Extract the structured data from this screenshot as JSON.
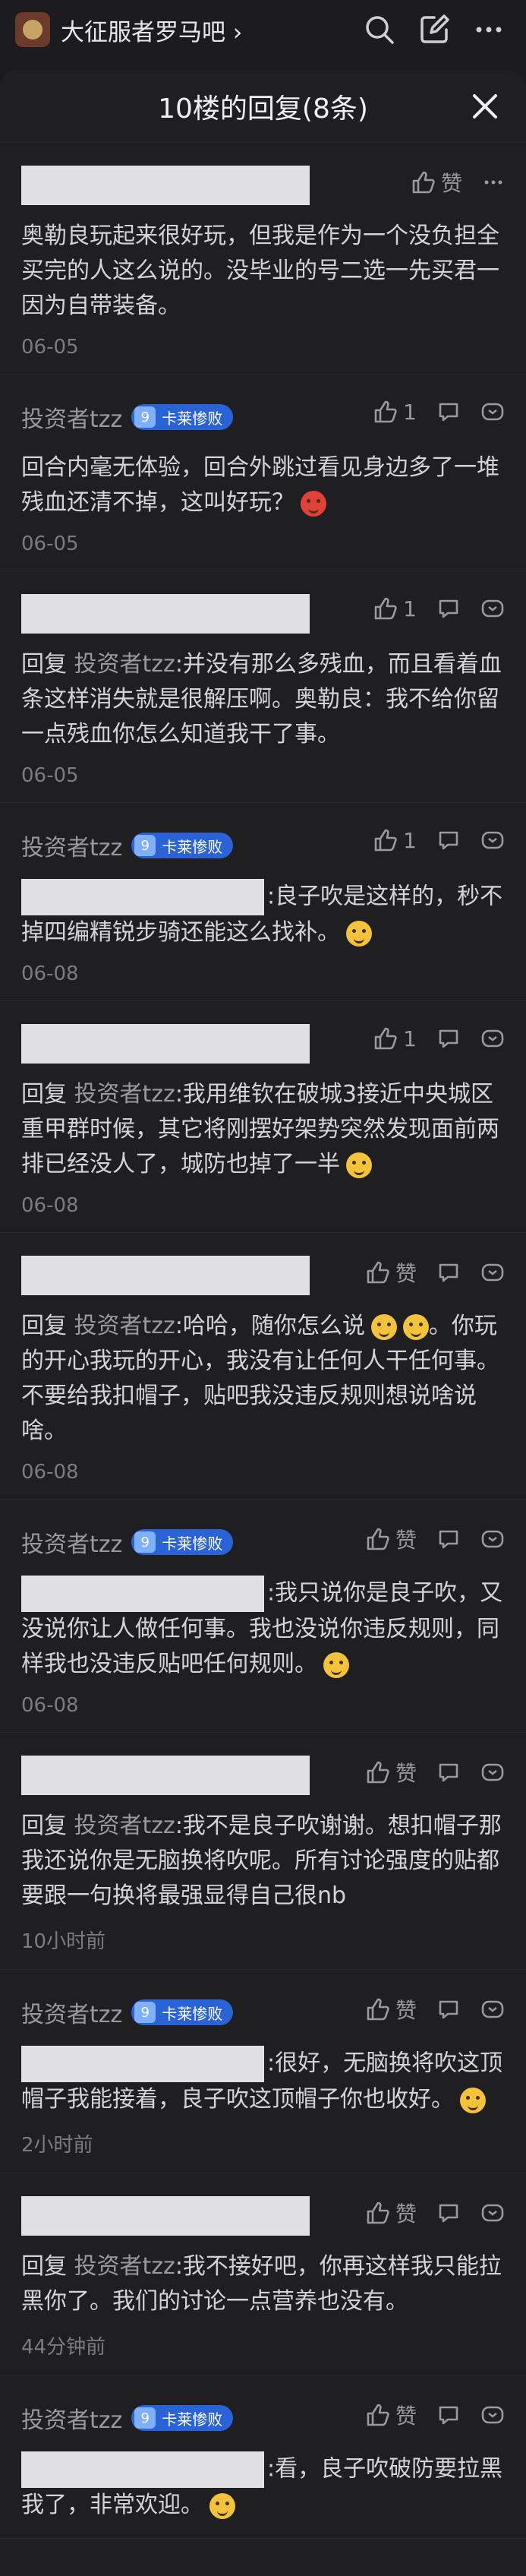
{
  "forum": {
    "name": "大征服者罗马吧"
  },
  "panel": {
    "title": "10楼的回复(8条)"
  },
  "comments": [
    {
      "user_redacted": true,
      "body": "奥勒良玩起来很好玩，但我是作为一个没负担全买完的人这么说的。没毕业的号二选一先买君一因为自带装备。",
      "date": "06-05",
      "like_label": "赞"
    },
    {
      "username": "投资者tzz",
      "badge_level": "9",
      "badge_name": "卡莱惨败",
      "body": "回合内毫无体验，回合外跳过看见身边多了一堆残血还清不掉，这叫好玩？",
      "date": "06-05",
      "like_count": "1"
    },
    {
      "user_redacted": true,
      "reply_prefix": "回复",
      "reply_to": "投资者tzz",
      "body": ":并没有那么多残血，而且看着血条这样消失就是很解压啊。奥勒良：我不给你留一点残血你怎么知道我干了事。",
      "date": "06-05",
      "like_count": "1"
    },
    {
      "username": "投资者tzz",
      "badge_level": "9",
      "badge_name": "卡莱惨败",
      "body": ":良子吹是这样的，秒不掉四编精锐步骑还能这么找补。",
      "date": "06-08",
      "like_count": "1"
    },
    {
      "user_redacted": true,
      "reply_prefix": "回复",
      "reply_to": "投资者tzz",
      "body": ":我用维钦在破城3接近中央城区重甲群时候，其它将刚摆好架势突然发现面前两排已经没人了，城防也掉了一半",
      "date": "06-08",
      "like_count": "1"
    },
    {
      "user_redacted": true,
      "reply_prefix": "回复",
      "reply_to": "投资者tzz",
      "body_a": ":哈哈，随你怎么说",
      "body_b": "。你玩的开心我玩的开心，我没有让任何人干任何事。不要给我扣帽子，贴吧我没违反规则想说啥说啥。",
      "date": "06-08",
      "like_label": "赞"
    },
    {
      "username": "投资者tzz",
      "badge_level": "9",
      "badge_name": "卡莱惨败",
      "body": ":我只说你是良子吹，又没说你让人做任何事。我也没说你违反规则，同样我也没违反贴吧任何规则。",
      "date": "06-08",
      "like_label": "赞"
    },
    {
      "user_redacted": true,
      "reply_prefix": "回复",
      "reply_to": "投资者tzz",
      "body": ":我不是良子吹谢谢。想扣帽子那我还说你是无脑换将吹呢。所有讨论强度的贴都要跟一句换将最强显得自己很nb",
      "date": "10小时前",
      "like_label": "赞"
    },
    {
      "username": "投资者tzz",
      "badge_level": "9",
      "badge_name": "卡莱惨败",
      "body": ":很好，无脑换将吹这顶帽子我能接着，良子吹这顶帽子你也收好。",
      "date": "2小时前",
      "like_label": "赞"
    },
    {
      "user_redacted": true,
      "reply_prefix": "回复",
      "reply_to": "投资者tzz",
      "body": ":我不接好吧，你再这样我只能拉黑你了。我们的讨论一点营养也没有。",
      "date": "44分钟前",
      "like_label": "赞"
    },
    {
      "username": "投资者tzz",
      "badge_level": "9",
      "badge_name": "卡莱惨败",
      "body": ":看，良子吹破防要拉黑我了，非常欢迎。",
      "date": "",
      "like_label": "赞"
    }
  ]
}
